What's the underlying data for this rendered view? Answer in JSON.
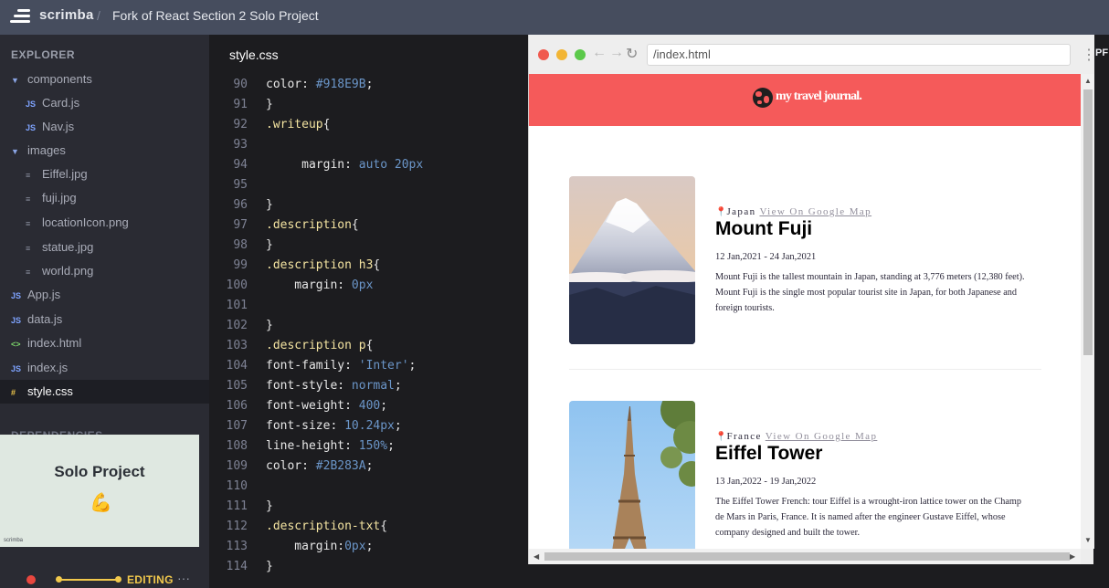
{
  "topbar": {
    "brand": "scrimba",
    "separator": "/",
    "title": "Fork of React Section 2 Solo Project"
  },
  "sidebar": {
    "explorer_title": "EXPLORER",
    "items": [
      {
        "label": "components",
        "icon": "chevron-down-icon"
      },
      {
        "label": "Card.js",
        "icon": "js-file-icon"
      },
      {
        "label": "Nav.js",
        "icon": "js-file-icon"
      },
      {
        "label": "images",
        "icon": "chevron-down-icon"
      },
      {
        "label": "Eiffel.jpg",
        "icon": "file-icon"
      },
      {
        "label": "fuji.jpg",
        "icon": "file-icon"
      },
      {
        "label": "locationIcon.png",
        "icon": "file-icon"
      },
      {
        "label": "statue.jpg",
        "icon": "file-icon"
      },
      {
        "label": "world.png",
        "icon": "file-icon"
      },
      {
        "label": "App.js",
        "icon": "js-file-icon"
      },
      {
        "label": "data.js",
        "icon": "js-file-icon"
      },
      {
        "label": "index.html",
        "icon": "html-file-icon"
      },
      {
        "label": "index.js",
        "icon": "js-file-icon"
      },
      {
        "label": "style.css",
        "icon": "css-file-icon",
        "active": true
      }
    ],
    "icon_glyphs": {
      "js": "JS",
      "folder": "▼",
      "file": "≡",
      "html": "<>",
      "css": "#"
    },
    "dependencies_title": "DEPENDENCIES"
  },
  "video": {
    "title": "Solo Project",
    "emoji": "💪",
    "brand": "scrimba"
  },
  "status": {
    "label": "EDITING",
    "more": "···",
    "progress": 1.0,
    "accent": "#f2c94c",
    "record_color": "#e8473f"
  },
  "editor": {
    "filename": "style.css",
    "lines": [
      {
        "n": "90",
        "tokens": [
          [
            "prop",
            "color: "
          ],
          [
            "val",
            "#918E9B"
          ],
          [
            "prop",
            ";"
          ]
        ]
      },
      {
        "n": "91",
        "tokens": [
          [
            "prop",
            "}"
          ]
        ]
      },
      {
        "n": "92",
        "tokens": [
          [
            "sel",
            ".writeup"
          ],
          [
            "prop",
            "{"
          ]
        ]
      },
      {
        "n": "93",
        "tokens": []
      },
      {
        "n": "94",
        "tokens": [
          [
            "prop",
            "     margin: "
          ],
          [
            "val",
            "auto 20px"
          ]
        ]
      },
      {
        "n": "95",
        "tokens": []
      },
      {
        "n": "96",
        "tokens": [
          [
            "prop",
            "}"
          ]
        ]
      },
      {
        "n": "97",
        "tokens": [
          [
            "sel",
            ".description"
          ],
          [
            "prop",
            "{"
          ]
        ]
      },
      {
        "n": "98",
        "tokens": [
          [
            "prop",
            "}"
          ]
        ]
      },
      {
        "n": "99",
        "tokens": [
          [
            "sel",
            ".description h3"
          ],
          [
            "prop",
            "{"
          ]
        ]
      },
      {
        "n": "100",
        "tokens": [
          [
            "prop",
            "    margin: "
          ],
          [
            "val",
            "0px"
          ]
        ]
      },
      {
        "n": "101",
        "tokens": []
      },
      {
        "n": "102",
        "tokens": [
          [
            "prop",
            "}"
          ]
        ]
      },
      {
        "n": "103",
        "tokens": [
          [
            "sel",
            ".description p"
          ],
          [
            "prop",
            "{"
          ]
        ]
      },
      {
        "n": "104",
        "tokens": [
          [
            "prop",
            "font-family: "
          ],
          [
            "str",
            "'Inter'"
          ],
          [
            "prop",
            ";"
          ]
        ]
      },
      {
        "n": "105",
        "tokens": [
          [
            "prop",
            "font-style: "
          ],
          [
            "val",
            "normal"
          ],
          [
            "prop",
            ";"
          ]
        ]
      },
      {
        "n": "106",
        "tokens": [
          [
            "prop",
            "font-weight: "
          ],
          [
            "val",
            "400"
          ],
          [
            "prop",
            ";"
          ]
        ]
      },
      {
        "n": "107",
        "tokens": [
          [
            "prop",
            "font-size: "
          ],
          [
            "val",
            "10.24px"
          ],
          [
            "prop",
            ";"
          ]
        ]
      },
      {
        "n": "108",
        "tokens": [
          [
            "prop",
            "line-height: "
          ],
          [
            "val",
            "150%"
          ],
          [
            "prop",
            ";"
          ]
        ]
      },
      {
        "n": "109",
        "tokens": [
          [
            "prop",
            "color: "
          ],
          [
            "val",
            "#2B283A"
          ],
          [
            "prop",
            ";"
          ]
        ]
      },
      {
        "n": "110",
        "tokens": []
      },
      {
        "n": "111",
        "tokens": [
          [
            "prop",
            "}"
          ]
        ]
      },
      {
        "n": "112",
        "tokens": [
          [
            "sel",
            ".description-txt"
          ],
          [
            "prop",
            "{"
          ]
        ]
      },
      {
        "n": "113",
        "tokens": [
          [
            "prop",
            "    margin:"
          ],
          [
            "val",
            "0px"
          ],
          [
            "prop",
            ";"
          ]
        ]
      },
      {
        "n": "114",
        "tokens": [
          [
            "prop",
            "}"
          ]
        ]
      }
    ]
  },
  "browser": {
    "url": "/index.html",
    "nav_glyphs": {
      "back": "←",
      "forward": "→",
      "reload": "↻",
      "menu": "⋮"
    },
    "traffic_lights": [
      "#f05a4f",
      "#f2b534",
      "#5bc94a"
    ],
    "edge_tab": "PF"
  },
  "site": {
    "title": "my travel journal.",
    "nav_color": "#f55a5a",
    "cards": [
      {
        "location": "Japan",
        "map_link": "View On Google Map",
        "title": "Mount Fuji",
        "dates": "12 Jan,2021 - 24 Jan,2021",
        "description": "Mount Fuji is the tallest mountain in Japan, standing at 3,776 meters (12,380 feet). Mount Fuji is the single most popular tourist site in Japan, for both Japanese and foreign tourists."
      },
      {
        "location": "France",
        "map_link": "View On Google Map",
        "title": "Eiffel Tower",
        "dates": "13 Jan,2022 - 19 Jan,2022",
        "description": "The Eiffel Tower French: tour Eiffel is a wrought-iron lattice tower on the Champ de Mars in Paris, France. It is named after the engineer Gustave Eiffel, whose company designed and built the tower."
      }
    ]
  }
}
